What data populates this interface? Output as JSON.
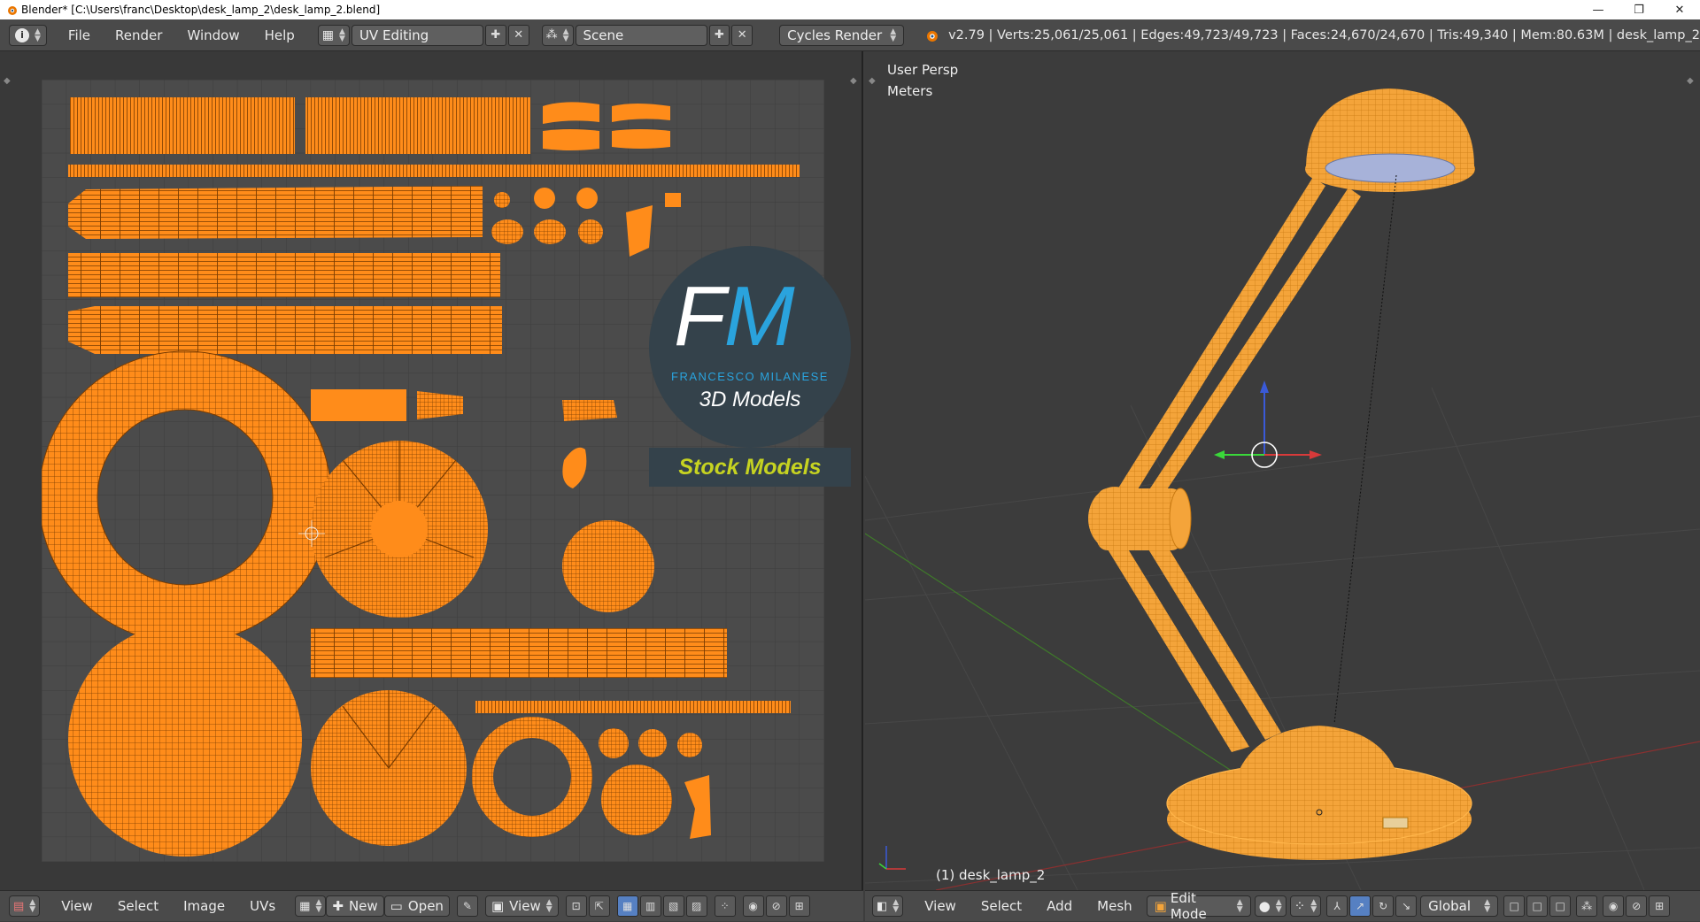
{
  "window": {
    "title": "Blender* [C:\\Users\\franc\\Desktop\\desk_lamp_2\\desk_lamp_2.blend]",
    "minimize": "—",
    "restore": "❐",
    "close": "✕"
  },
  "infobar": {
    "menus": [
      "File",
      "Render",
      "Window",
      "Help"
    ],
    "screen_layout": "UV Editing",
    "scene": "Scene",
    "render_engine": "Cycles Render",
    "stats": "v2.79 | Verts:25,061/25,061 | Edges:49,723/49,723 | Faces:24,670/24,670 | Tris:49,340 | Mem:80.63M | desk_lamp_2"
  },
  "uv_editor": {
    "menus": [
      "View",
      "Select",
      "Image",
      "UVs"
    ],
    "new_label": "New",
    "open_label": "Open",
    "view_label": "View"
  },
  "view3d": {
    "view_name": "User Persp",
    "units": "Meters",
    "object_label": "(1) desk_lamp_2",
    "menus": [
      "View",
      "Select",
      "Add",
      "Mesh"
    ],
    "mode": "Edit Mode",
    "orientation": "Global"
  },
  "watermark": {
    "letters_f": "F",
    "letters_m": "M",
    "name": "FRANCESCO MILANESE",
    "subtitle": "3D Models",
    "banner": "Stock Models"
  },
  "colors": {
    "uv_orange": "#ff8c1a",
    "lamp_orange": "#f4a43a",
    "accent_blue": "#5680c2",
    "fm_blue": "#2aa3dd",
    "banner_yellow": "#c6d321"
  }
}
